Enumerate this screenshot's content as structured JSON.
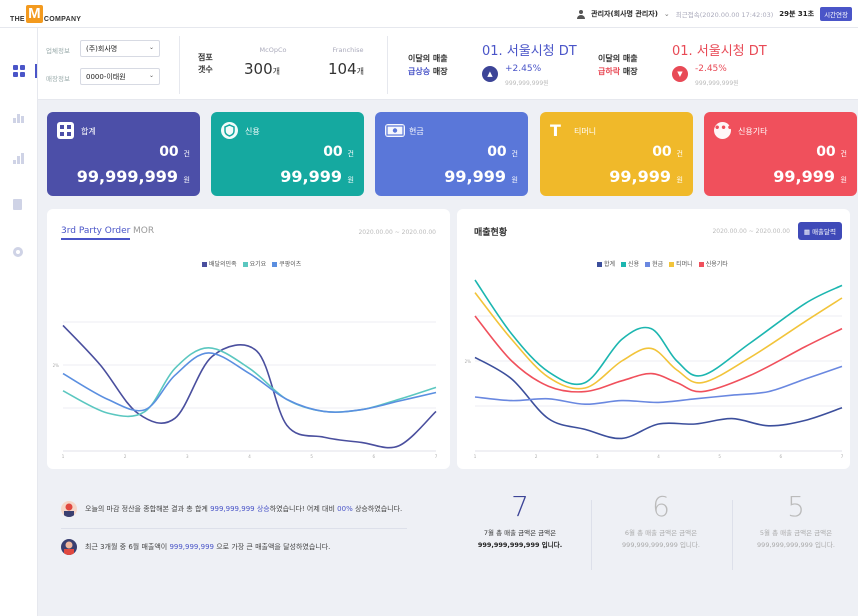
{
  "header": {
    "logo_the": "THE",
    "logo_m": "M",
    "logo_company": "COMPANY",
    "user": "관리자(회사명 관리자)",
    "last_login": "최근접속(2020.00.00 17:42:03)",
    "remaining_time": "29분 31초",
    "extend_button": "시간연장"
  },
  "filters": {
    "company_label": "업체정보",
    "company_value": "(주)회사명",
    "store_label": "매장정보",
    "store_value": "0000-이태원"
  },
  "stores": {
    "title_line1": "점포",
    "title_line2": "갯수",
    "mcopco_label": "McOpCo",
    "mcopco_value": "300",
    "franchise_label": "Franchise",
    "franchise_value": "104",
    "unit": "개"
  },
  "rank_up": {
    "label_line1": "이달의 매출",
    "label_highlight": "급상승",
    "label_tail": " 매장",
    "store": "01. 서울시청 DT",
    "pct": "+2.45%",
    "sub": "999,999,999원",
    "arrow": "▲",
    "color": "#4a55c8"
  },
  "rank_down": {
    "label_line1": "이달의 매출",
    "label_highlight": "급하락",
    "label_tail": " 매장",
    "store": "01. 서울시청 DT",
    "pct": "-2.45%",
    "sub": "999,999,999원",
    "arrow": "▼",
    "color": "#e84a56"
  },
  "cards": [
    {
      "label": "합계",
      "count": "00",
      "count_unit": "건",
      "amount": "99,999,999",
      "amount_unit": "원",
      "color": "#4c4fa8",
      "icon": "calculator-icon"
    },
    {
      "label": "신용",
      "count": "00",
      "count_unit": "건",
      "amount": "99,999",
      "amount_unit": "원",
      "color": "#15a9a0",
      "icon": "credit-shield-icon"
    },
    {
      "label": "현금",
      "count": "00",
      "count_unit": "건",
      "amount": "99,999",
      "amount_unit": "원",
      "color": "#5a77d9",
      "icon": "cash-icon"
    },
    {
      "label": "티머니",
      "count": "00",
      "count_unit": "건",
      "amount": "99,999",
      "amount_unit": "원",
      "color": "#f0b92a",
      "icon": "tmoney-icon"
    },
    {
      "label": "신용기타",
      "count": "00",
      "count_unit": "건",
      "amount": "99,999",
      "amount_unit": "원",
      "color": "#f0505c",
      "icon": "more-dots-icon"
    }
  ],
  "left_chart": {
    "tab_active": "3rd Party Order",
    "tab_inactive": "MOR",
    "date_range": "2020.00.00 ~ 2020.00.00",
    "legend": [
      "배달의민족",
      "요기요",
      "쿠팡이츠"
    ],
    "colors": [
      "#4a4f9e",
      "#5bc7c0",
      "#5b8fe0"
    ],
    "y_tick": "2%",
    "x_ticks": [
      "1",
      "2",
      "3",
      "4",
      "5",
      "6",
      "7"
    ],
    "chart_data": {
      "type": "line",
      "series": [
        {
          "name": "배달의민족",
          "values": [
            [
              0,
              0.73
            ],
            [
              0.1,
              0.5
            ],
            [
              0.2,
              0.22
            ],
            [
              0.3,
              0.19
            ],
            [
              0.4,
              0.55
            ],
            [
              0.52,
              0.58
            ],
            [
              0.6,
              0.15
            ],
            [
              0.7,
              0.08
            ],
            [
              0.8,
              0.05
            ],
            [
              0.9,
              0.03
            ],
            [
              1,
              0.23
            ]
          ]
        },
        {
          "name": "요기요",
          "values": [
            [
              0,
              0.35
            ],
            [
              0.12,
              0.22
            ],
            [
              0.22,
              0.23
            ],
            [
              0.3,
              0.48
            ],
            [
              0.39,
              0.6
            ],
            [
              0.5,
              0.48
            ],
            [
              0.6,
              0.3
            ],
            [
              0.7,
              0.23
            ],
            [
              0.8,
              0.24
            ],
            [
              0.9,
              0.3
            ],
            [
              1,
              0.37
            ]
          ]
        },
        {
          "name": "쿠팡이츠",
          "values": [
            [
              0,
              0.45
            ],
            [
              0.12,
              0.3
            ],
            [
              0.22,
              0.24
            ],
            [
              0.3,
              0.44
            ],
            [
              0.39,
              0.57
            ],
            [
              0.5,
              0.45
            ],
            [
              0.6,
              0.3
            ],
            [
              0.7,
              0.23
            ],
            [
              0.8,
              0.24
            ],
            [
              0.9,
              0.29
            ],
            [
              1,
              0.34
            ]
          ]
        }
      ]
    }
  },
  "right_chart": {
    "title": "매출현황",
    "date_range": "2020.00.00 ~ 2020.00.00",
    "button": "매출달력",
    "legend": [
      "합계",
      "신용",
      "현금",
      "티머니",
      "신용기타"
    ],
    "colors": [
      "#3c4f9c",
      "#1cb6b0",
      "#6a88e0",
      "#f2c43a",
      "#f0505c"
    ],
    "y_tick": "2%",
    "x_ticks": [
      "1",
      "2",
      "3",
      "4",
      "5",
      "6",
      "7"
    ],
    "chart_data": {
      "type": "line",
      "series": [
        {
          "name": "합계",
          "values": [
            [
              0,
              0.52
            ],
            [
              0.1,
              0.4
            ],
            [
              0.2,
              0.18
            ],
            [
              0.3,
              0.12
            ],
            [
              0.4,
              0.07
            ],
            [
              0.5,
              0.15
            ],
            [
              0.6,
              0.15
            ],
            [
              0.7,
              0.18
            ],
            [
              0.8,
              0.14
            ],
            [
              0.9,
              0.17
            ],
            [
              1,
              0.24
            ]
          ]
        },
        {
          "name": "신용",
          "values": [
            [
              0,
              0.95
            ],
            [
              0.1,
              0.65
            ],
            [
              0.2,
              0.44
            ],
            [
              0.3,
              0.38
            ],
            [
              0.4,
              0.62
            ],
            [
              0.48,
              0.68
            ],
            [
              0.55,
              0.5
            ],
            [
              0.62,
              0.42
            ],
            [
              0.75,
              0.6
            ],
            [
              0.9,
              0.82
            ],
            [
              1,
              0.92
            ]
          ]
        },
        {
          "name": "현금",
          "values": [
            [
              0,
              0.3
            ],
            [
              0.1,
              0.28
            ],
            [
              0.2,
              0.29
            ],
            [
              0.3,
              0.26
            ],
            [
              0.4,
              0.28
            ],
            [
              0.5,
              0.27
            ],
            [
              0.6,
              0.29
            ],
            [
              0.7,
              0.31
            ],
            [
              0.8,
              0.33
            ],
            [
              0.9,
              0.4
            ],
            [
              1,
              0.47
            ]
          ]
        },
        {
          "name": "티머니",
          "values": [
            [
              0,
              0.88
            ],
            [
              0.1,
              0.62
            ],
            [
              0.2,
              0.41
            ],
            [
              0.3,
              0.35
            ],
            [
              0.4,
              0.5
            ],
            [
              0.48,
              0.57
            ],
            [
              0.55,
              0.45
            ],
            [
              0.62,
              0.38
            ],
            [
              0.75,
              0.52
            ],
            [
              0.9,
              0.72
            ],
            [
              1,
              0.85
            ]
          ]
        },
        {
          "name": "신용기타",
          "values": [
            [
              0,
              0.75
            ],
            [
              0.1,
              0.5
            ],
            [
              0.2,
              0.36
            ],
            [
              0.3,
              0.33
            ],
            [
              0.4,
              0.39
            ],
            [
              0.48,
              0.43
            ],
            [
              0.55,
              0.38
            ],
            [
              0.62,
              0.33
            ],
            [
              0.75,
              0.42
            ],
            [
              0.9,
              0.58
            ],
            [
              1,
              0.68
            ]
          ]
        }
      ]
    }
  },
  "messages": {
    "msg1_pre": "오늘의 마감 정산을 종합해본 결과 총 합계 ",
    "msg1_hl": "999,999,999 상승",
    "msg1_mid": "하였습니다! 어제 대비 ",
    "msg1_hl2": "00%",
    "msg1_post": " 상승하였습니다.",
    "msg2_pre": "최근 3개월 중 6월 매출액이 ",
    "msg2_hl": "999,999,999",
    "msg2_post": " 으로 가장 큰 매출액을 달성하였습니다."
  },
  "months": [
    {
      "num": "7",
      "line1": "7월 총 매출 금액은 금액은",
      "line2": "999,999,999,999 입니다.",
      "active": true
    },
    {
      "num": "6",
      "line1": "6월 총 매출 금액은 금액은",
      "line2": "999,999,999,999 입니다.",
      "active": false
    },
    {
      "num": "5",
      "line1": "5월 총 매출 금액은 금액은",
      "line2": "999,999,999,999 입니다.",
      "active": false
    }
  ]
}
